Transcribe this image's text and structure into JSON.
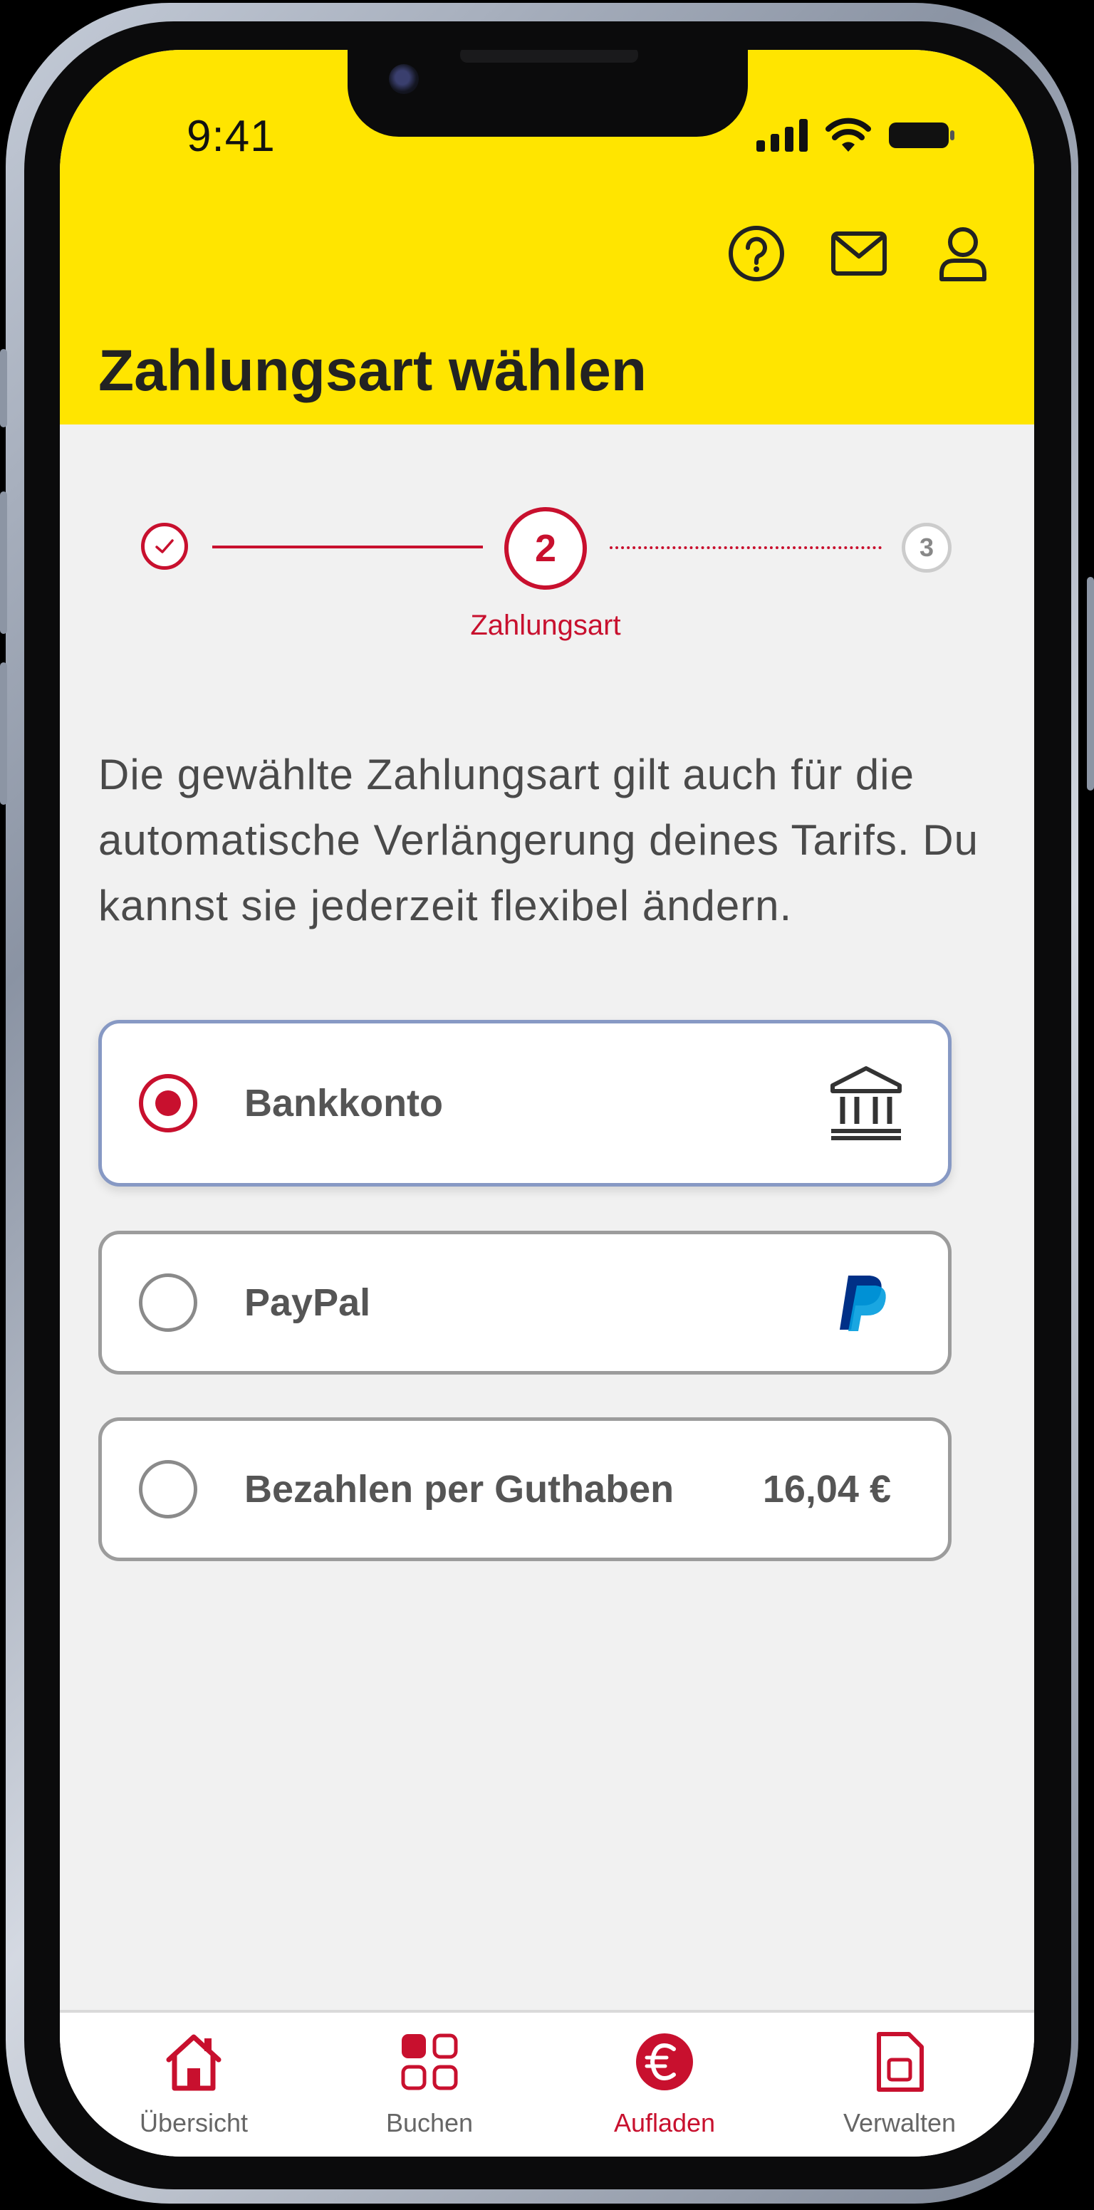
{
  "status_bar": {
    "time": "9:41"
  },
  "header": {
    "title": "Zahlungsart wählen",
    "icons": [
      "help-icon",
      "mail-icon",
      "profile-icon"
    ]
  },
  "stepper": {
    "steps": [
      {
        "state": "done"
      },
      {
        "number": "2",
        "label": "Zahlungsart",
        "state": "active"
      },
      {
        "number": "3",
        "state": "upcoming"
      }
    ]
  },
  "intro_text": "Die gewählte Zahlungsart gilt auch für die automatische Verlängerung deines Tarifs. Du kannst sie jederzeit flexibel ändern.",
  "payment_options": [
    {
      "label": "Bankkonto",
      "selected": true,
      "icon": "bank-icon"
    },
    {
      "label": "PayPal",
      "selected": false,
      "icon": "paypal-icon"
    },
    {
      "label": "Bezahlen per Guthaben",
      "selected": false,
      "value": "16,04 €"
    }
  ],
  "tab_bar": [
    {
      "label": "Übersicht",
      "icon": "home-icon",
      "active": false
    },
    {
      "label": "Buchen",
      "icon": "grid-icon",
      "active": false
    },
    {
      "label": "Aufladen",
      "icon": "euro-icon",
      "active": true
    },
    {
      "label": "Verwalten",
      "icon": "sim-card-icon",
      "active": false
    }
  ],
  "colors": {
    "brand_yellow": "#ffe500",
    "accent_red": "#c8102e",
    "background": "#f1f1f1"
  }
}
